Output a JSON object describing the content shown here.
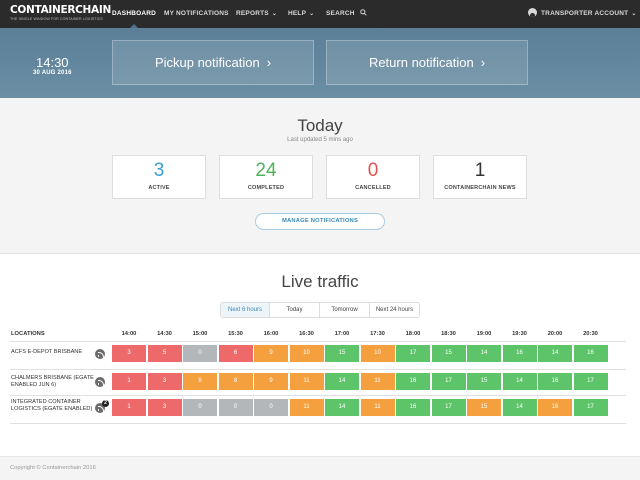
{
  "brand": {
    "name": "CONTAINERCHAIN",
    "tagline": "THE SINGLE WINDOW FOR CONTAINER LOGISTICS"
  },
  "nav": {
    "items": [
      {
        "label": "DASHBOARD",
        "active": true
      },
      {
        "label": "MY NOTIFICATIONS"
      },
      {
        "label": "REPORTS",
        "caret": "chevron-down-icon"
      },
      {
        "label": "HELP",
        "caret": "chevron-down-icon"
      },
      {
        "label": "SEARCH",
        "icon": "search-icon"
      }
    ],
    "account": {
      "label": "TRANSPORTER ACCOUNT",
      "icon": "user-icon"
    }
  },
  "hero": {
    "time": "14:30",
    "date": "30 AUG 2016",
    "pickup_label": "Pickup notification",
    "return_label": "Return notification"
  },
  "today": {
    "title": "Today",
    "updated": "Last updated 5 mins ago",
    "stats": [
      {
        "value": "3",
        "label": "ACTIVE",
        "color": "#3a9fd4"
      },
      {
        "value": "24",
        "label": "COMPLETED",
        "color": "#4bb35a"
      },
      {
        "value": "0",
        "label": "CANCELLED",
        "color": "#e0524f"
      },
      {
        "value": "1",
        "label": "CONTAINERCHAIN NEWS",
        "color": "#333333"
      }
    ],
    "manage_label": "MANAGE NOTIFICATIONS"
  },
  "live": {
    "title": "Live traffic",
    "tabs": [
      "Next 6 hours",
      "Today",
      "Tomorrow",
      "Next 24 hours"
    ],
    "active_tab": 0,
    "locations_header": "LOCATIONS",
    "times": [
      "14:00",
      "14:30",
      "15:00",
      "15:30",
      "16:00",
      "16:30",
      "17:00",
      "17:30",
      "18:00",
      "18:30",
      "19:00",
      "19:30",
      "20:00",
      "20:30"
    ],
    "rows": [
      {
        "name": "ACFS E-DEPOT BRISBANE",
        "badge": "",
        "values": [
          "3",
          "5",
          "0",
          "6",
          "9",
          "10",
          "15",
          "10",
          "17",
          "15",
          "14",
          "16",
          "14",
          "16"
        ],
        "statuses": [
          "red",
          "red",
          "gray",
          "red",
          "orange",
          "orange",
          "green",
          "orange",
          "green",
          "green",
          "green",
          "green",
          "green",
          "green"
        ]
      },
      {
        "name": "CHALMERS BRISBANE (EGATE ENABLED JUN 6)",
        "badge": "",
        "values": [
          "1",
          "3",
          "8",
          "8",
          "9",
          "11",
          "14",
          "11",
          "16",
          "17",
          "15",
          "14",
          "16",
          "17"
        ],
        "statuses": [
          "red",
          "red",
          "orange",
          "orange",
          "orange",
          "orange",
          "green",
          "orange",
          "green",
          "green",
          "green",
          "green",
          "green",
          "green"
        ]
      },
      {
        "name": "INTEGRATED CONTAINER LOGISTICS (EGATE ENABLED)",
        "badge": "2",
        "values": [
          "1",
          "3",
          "0",
          "0",
          "0",
          "11",
          "14",
          "11",
          "16",
          "17",
          "15",
          "14",
          "16",
          "17"
        ],
        "statuses": [
          "red",
          "red",
          "gray",
          "gray",
          "gray",
          "orange",
          "green",
          "orange",
          "green",
          "green",
          "orange",
          "green",
          "orange",
          "green"
        ]
      }
    ],
    "status_colors": {
      "red": "#ee6a6a",
      "gray": "#b4b7ba",
      "orange": "#f5a03f",
      "green": "#5ec46a"
    }
  },
  "footer": {
    "copyright": "Copyright © Containerchain 2016"
  }
}
